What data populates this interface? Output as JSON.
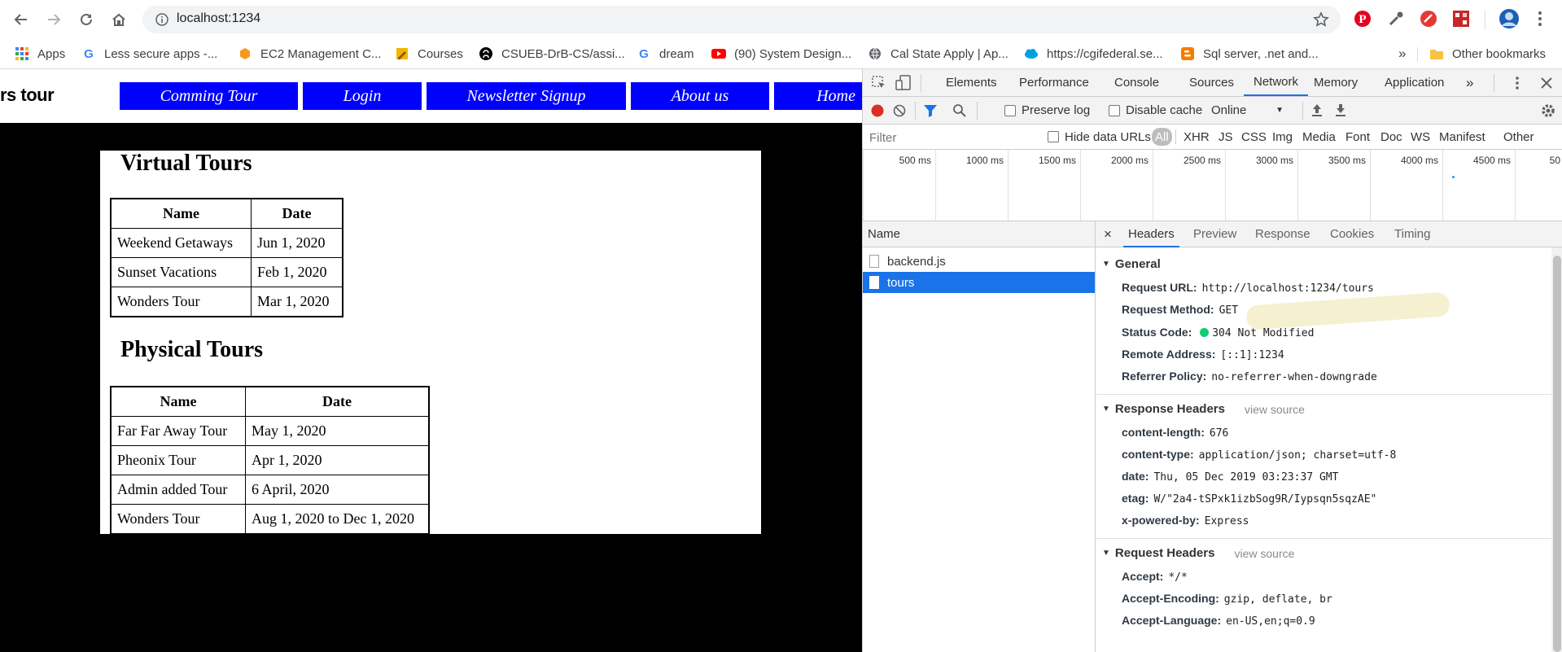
{
  "browser": {
    "url_text": "localhost:1234",
    "bookmarks": [
      {
        "label": "Apps",
        "icon": "apps-grid-icon"
      },
      {
        "label": "Less secure apps -...",
        "icon": "google-icon"
      },
      {
        "label": "EC2 Management C...",
        "icon": "aws-icon"
      },
      {
        "label": "Courses",
        "icon": "pencil-icon"
      },
      {
        "label": "CSUEB-DrB-CS/assi...",
        "icon": "github-icon"
      },
      {
        "label": "dream",
        "icon": "google-icon"
      },
      {
        "label": "(90) System Design...",
        "icon": "youtube-icon"
      },
      {
        "label": "Cal State Apply | Ap...",
        "icon": "globe-icon"
      },
      {
        "label": "https://cgifederal.se...",
        "icon": "salesforce-cloud-icon"
      },
      {
        "label": "Sql server, .net and...",
        "icon": "blogger-icon"
      }
    ],
    "bookmarks_overflow": "»",
    "other_bookmarks": "Other bookmarks"
  },
  "site": {
    "title_partial": "rs tour",
    "nav": [
      "Comming Tour",
      "Login",
      "Newsletter Signup",
      "About us",
      "Home"
    ],
    "nav_color": "#0000ff",
    "virtual": {
      "heading": "Virtual Tours",
      "headers": [
        "Name",
        "Date"
      ],
      "rows": [
        [
          "Weekend Getaways",
          "Jun 1, 2020"
        ],
        [
          "Sunset Vacations",
          "Feb 1, 2020"
        ],
        [
          "Wonders Tour",
          "Mar 1, 2020"
        ]
      ]
    },
    "physical": {
      "heading": "Physical Tours",
      "headers": [
        "Name",
        "Date"
      ],
      "rows": [
        [
          "Far Far Away Tour",
          "May 1, 2020"
        ],
        [
          "Pheonix Tour",
          "Apr 1, 2020"
        ],
        [
          "Admin added Tour",
          "6 April, 2020"
        ],
        [
          "Wonders Tour",
          "Aug 1, 2020 to Dec 1, 2020"
        ]
      ]
    }
  },
  "devtools": {
    "tabs": [
      "Elements",
      "Performance",
      "Console",
      "Sources",
      "Network",
      "Memory",
      "Application"
    ],
    "more_tabs": "»",
    "active_tab": "Network",
    "toolbar": {
      "preserve_log": "Preserve log",
      "disable_cache": "Disable cache",
      "throttle": "Online"
    },
    "filter": {
      "placeholder": "Filter",
      "hide_data_urls": "Hide data URLs",
      "types": [
        "All",
        "XHR",
        "JS",
        "CSS",
        "Img",
        "Media",
        "Font",
        "Doc",
        "WS",
        "Manifest",
        "Other"
      ]
    },
    "timeline_ticks": [
      "500 ms",
      "1000 ms",
      "1500 ms",
      "2000 ms",
      "2500 ms",
      "3000 ms",
      "3500 ms",
      "4000 ms",
      "4500 ms",
      "50"
    ],
    "list_header": "Name",
    "requests": [
      "backend.js",
      "tours"
    ],
    "selected_request": "tours",
    "detail_close": "×",
    "detail_tabs": [
      "Headers",
      "Preview",
      "Response",
      "Cookies",
      "Timing"
    ],
    "general": {
      "title": "General",
      "request_url_k": "Request URL:",
      "request_url_v": "http://localhost:1234/tours",
      "method_k": "Request Method:",
      "method_v": "GET",
      "status_k": "Status Code:",
      "status_v": "304 Not Modified",
      "remote_k": "Remote Address:",
      "remote_v": "[::1]:1234",
      "referrer_k": "Referrer Policy:",
      "referrer_v": "no-referrer-when-downgrade"
    },
    "response_headers": {
      "title": "Response Headers",
      "view_source": "view source",
      "items": [
        {
          "k": "content-length:",
          "v": "676"
        },
        {
          "k": "content-type:",
          "v": "application/json; charset=utf-8"
        },
        {
          "k": "date:",
          "v": "Thu, 05 Dec 2019 03:23:37 GMT"
        },
        {
          "k": "etag:",
          "v": "W/\"2a4-tSPxk1izbSog9R/Iypsqn5sqzAE\""
        },
        {
          "k": "x-powered-by:",
          "v": "Express"
        }
      ]
    },
    "request_headers": {
      "title": "Request Headers",
      "view_source": "view source",
      "items": [
        {
          "k": "Accept:",
          "v": "*/*"
        },
        {
          "k": "Accept-Encoding:",
          "v": "gzip, deflate, br"
        },
        {
          "k": "Accept-Language:",
          "v": "en-US,en;q=0.9"
        }
      ]
    }
  }
}
